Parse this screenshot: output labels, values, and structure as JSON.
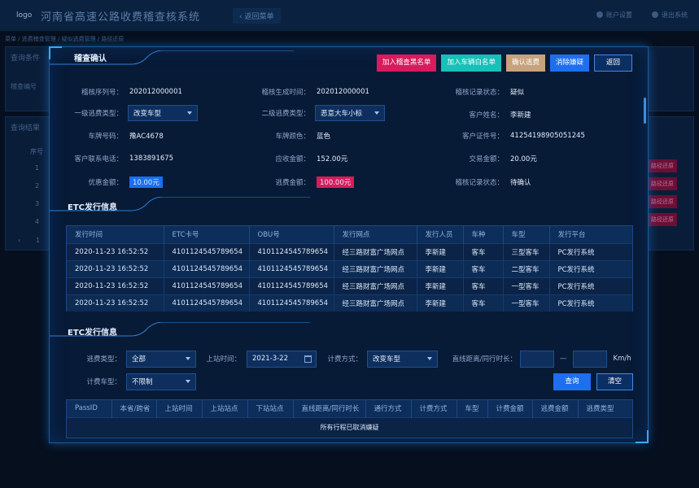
{
  "app": {
    "logo": "logo",
    "title": "河南省高速公路收费稽查核系统",
    "back_label": "返回菜单",
    "user_settings": "账户设置",
    "logout": "退出系统",
    "breadcrumb": "菜单 / 逃费稽查管理 / 疑似逃费管理 / 路径还原",
    "bg_panel_query": "查询条件",
    "bg_field_label": "稽查编号",
    "bg_panel_result": "查询结果",
    "bg_col": "序号",
    "bg_rows": [
      "1",
      "2",
      "3",
      "4"
    ],
    "bg_page": "1",
    "bg_action": "路径还原"
  },
  "modal": {
    "title": "稽查确认",
    "buttons": {
      "blacklist": "加入稽查黑名单",
      "whitelist": "加入车辆白名单",
      "confirm": "确认逃费",
      "clear_suspect": "消除嫌疑",
      "back": "返回"
    },
    "info": {
      "seq_label": "稽核序列号：",
      "seq": "202012000001",
      "gen_time_label": "稽核生成时间：",
      "gen_time": "202012000001",
      "record_status_label": "稽核记录状态：",
      "record_status": "疑似",
      "type1_label": "一级逃费类型：",
      "type1": "改变车型",
      "type2_label": "二级逃费类型：",
      "type2": "恶意大车小标",
      "customer_label": "客户姓名：",
      "customer": "李新建",
      "plate_label": "车牌号码：",
      "plate": "豫AC4678",
      "color_label": "车牌颜色：",
      "color": "蓝色",
      "cert_label": "客户证件号：",
      "cert": "41254198905051245",
      "phone_label": "客户联系电话：",
      "phone": "1383891675",
      "due_label": "应收金额：",
      "due": "152.00元",
      "txn_label": "交易金额：",
      "txn": "20.00元",
      "discount_label": "优惠金额：",
      "discount": "10.00元",
      "evade_label": "逃费金额：",
      "evade": "100.00元",
      "record_status2_label": "稽核记录状态：",
      "record_status2": "待确认"
    },
    "etc_title": "ETC发行信息",
    "etc_table": {
      "headers": [
        "发行时间",
        "ETC卡号",
        "OBU号",
        "发行网点",
        "发行人员",
        "车种",
        "车型",
        "发行平台"
      ],
      "rows": [
        [
          "2020-11-23 16:52:52",
          "4101124545789654",
          "4101124545789654",
          "经三路财富广场网点",
          "李新建",
          "客车",
          "三型客车",
          "PC发行系统"
        ],
        [
          "2020-11-23 16:52:52",
          "4101124545789654",
          "4101124545789654",
          "经三路财富广场网点",
          "李新建",
          "客车",
          "二型客车",
          "PC发行系统"
        ],
        [
          "2020-11-23 16:52:52",
          "4101124545789654",
          "4101124545789654",
          "经三路财富广场网点",
          "李新建",
          "客车",
          "一型客车",
          "PC发行系统"
        ],
        [
          "2020-11-23 16:52:52",
          "4101124545789654",
          "4101124545789654",
          "经三路财富广场网点",
          "李新建",
          "客车",
          "一型客车",
          "PC发行系统"
        ]
      ]
    },
    "etc2_title": "ETC发行信息",
    "filters": {
      "evade_type_label": "逃费类型：",
      "evade_type": "全部",
      "board_time_label": "上站时间：",
      "board_time": "2021-3-22",
      "charge_mode_label": "计费方式：",
      "charge_mode": "改变车型",
      "distance_label": "直线距离/同行时长：",
      "distance_from": "",
      "distance_to": "",
      "distance_sep": "—",
      "unit": "Km/h",
      "vehicle_type_label": "计费车型：",
      "vehicle_type": "不限制",
      "query": "查询",
      "clear": "清空"
    },
    "pass_table": {
      "headers": [
        "PassID",
        "本省/跨省",
        "上站时间",
        "上站站点",
        "下站站点",
        "直线距离/同行时长",
        "通行方式",
        "计费方式",
        "车型",
        "计费金额",
        "逃费金额",
        "逃费类型"
      ],
      "empty": "所有行程已取消嫌疑"
    }
  }
}
